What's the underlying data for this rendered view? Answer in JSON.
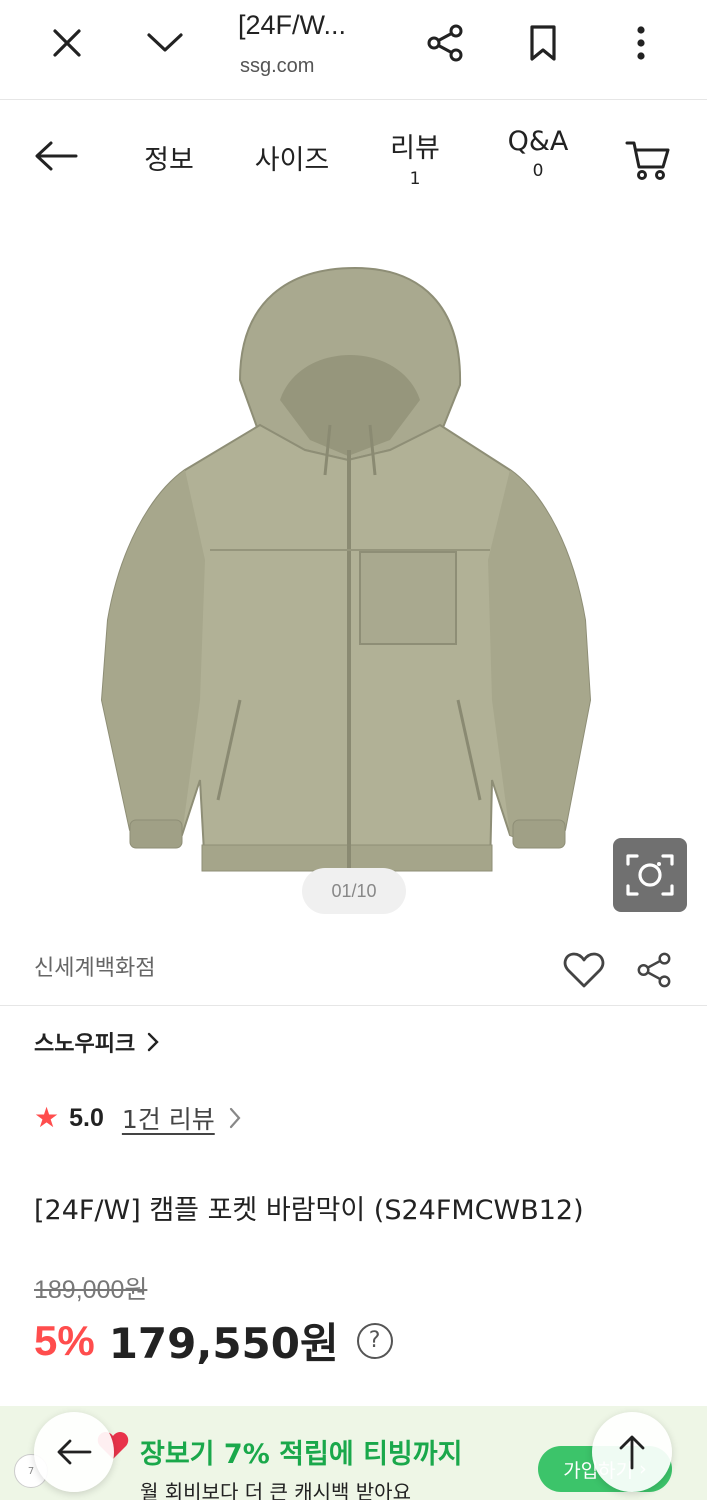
{
  "browser": {
    "title": "[24F/W...",
    "url": "ssg.com"
  },
  "tabs": [
    {
      "label": "정보",
      "count": ""
    },
    {
      "label": "사이즈",
      "count": ""
    },
    {
      "label": "리뷰",
      "count": "1"
    },
    {
      "label": "Q&A",
      "count": "0"
    }
  ],
  "image": {
    "counter": "01/10"
  },
  "seller": {
    "name": "신세계백화점"
  },
  "product": {
    "brand": "스노우피크",
    "rating_score": "5.0",
    "review_link": "1건 리뷰",
    "title": "[24F/W] 캠플 포켓 바람막이 (S24FMCWB12)",
    "original_price": "189,000원",
    "discount": "5%",
    "price": "179,550원"
  },
  "promo": {
    "headline": "장보기 7% 적립에 티빙까지",
    "subtext": "월 회비보다 더 큰 캐시백 받아요",
    "join_label": "가입하기",
    "logo_text": "7"
  },
  "colors": {
    "accent_red": "#ff4d4d",
    "promo_green": "#1aa84b",
    "promo_bg": "#eef6e6"
  }
}
